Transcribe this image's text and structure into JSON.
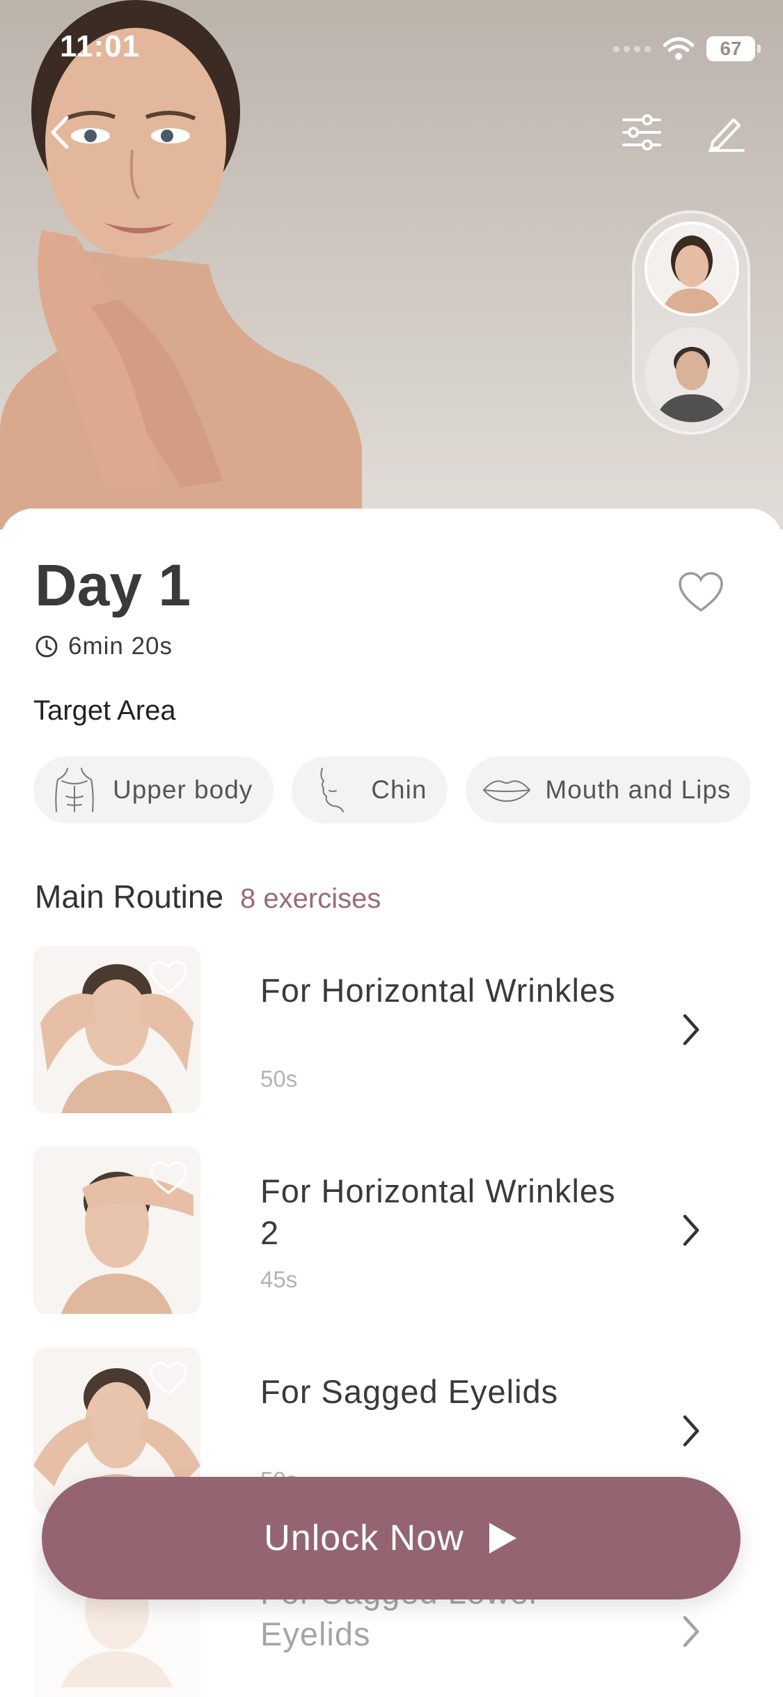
{
  "status_bar": {
    "time": "11:01",
    "battery": "67"
  },
  "hero": {
    "icons": {
      "back": "chevron-left-icon",
      "filter": "sliders-icon",
      "edit": "pencil-icon"
    },
    "avatars": [
      {
        "name": "female-avatar"
      },
      {
        "name": "male-avatar"
      }
    ]
  },
  "day": {
    "title": "Day 1",
    "duration": "6min 20s"
  },
  "target_area": {
    "label": "Target Area",
    "chips": [
      {
        "label": "Upper body",
        "icon": "upper-body-icon"
      },
      {
        "label": "Chin",
        "icon": "chin-icon"
      },
      {
        "label": "Mouth and Lips",
        "icon": "lips-icon"
      }
    ]
  },
  "routine": {
    "title": "Main Routine",
    "count": "8 exercises",
    "exercises": [
      {
        "title": "For Horizontal Wrinkles",
        "time": "50s"
      },
      {
        "title": "For Horizontal Wrinkles 2",
        "time": "45s"
      },
      {
        "title": "For Sagged Eyelids",
        "time": "50s"
      },
      {
        "title": "For Sagged Lower Eyelids",
        "time": ""
      }
    ]
  },
  "cta": {
    "label": "Unlock Now"
  },
  "colors": {
    "accent": "#946570",
    "accent_text": "#9b6b76"
  }
}
